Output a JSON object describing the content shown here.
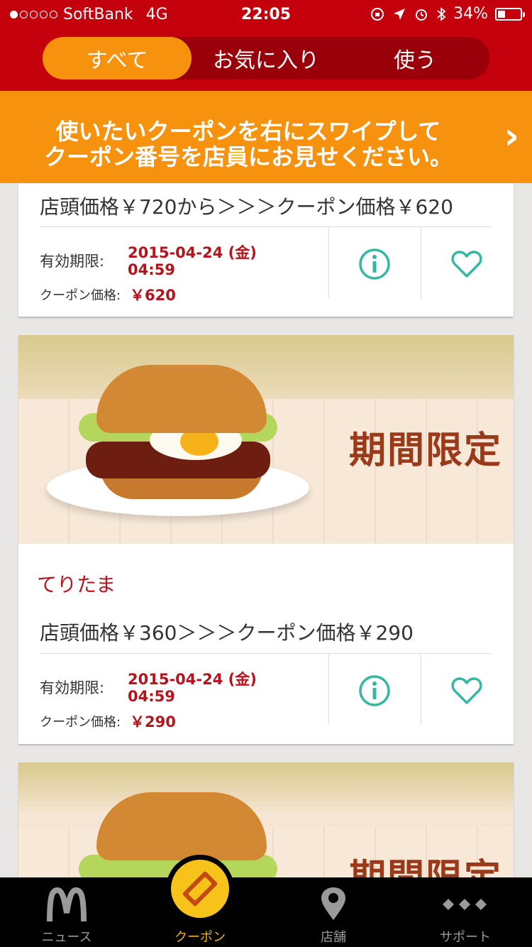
{
  "status_bar": {
    "carrier": "SoftBank",
    "network": "4G",
    "time": "22:05",
    "battery": "34%",
    "battery_level": 0.34,
    "signal_bars": 1,
    "signal_total": 5
  },
  "segmented": {
    "tabs": [
      {
        "label": "すべて",
        "active": true
      },
      {
        "label": "お気に入り",
        "active": false
      },
      {
        "label": "使う",
        "active": false
      }
    ]
  },
  "banner": {
    "line1": "使いたいクーポンを右にスワイプして",
    "line2": "クーポン番号を店員にお見せください。",
    "chevron": "›"
  },
  "coupons": [
    {
      "name": "",
      "price_text": "店頭価格￥720から＞＞＞クーポン価格￥620",
      "valid_label": "有効期限:",
      "valid_date": "2015-04-24 (金)",
      "valid_time": "04:59",
      "coupon_price_label": "クーポン価格:",
      "coupon_price": "￥620"
    },
    {
      "badge": "期間限定",
      "name": "てりたま",
      "price_text": "店頭価格￥360＞＞＞クーポン価格￥290",
      "valid_label": "有効期限:",
      "valid_date": "2015-04-24 (金)",
      "valid_time": "04:59",
      "coupon_price_label": "クーポン価格:",
      "coupon_price": "￥290"
    },
    {
      "badge": "期間限定"
    }
  ],
  "tab_bar": {
    "items": [
      {
        "label": "ニュース",
        "icon": "mcdonalds-logo-icon",
        "active": false
      },
      {
        "label": "クーポン",
        "icon": "coupon-icon",
        "active": true
      },
      {
        "label": "店舗",
        "icon": "location-pin-icon",
        "active": false
      },
      {
        "label": "サポート",
        "icon": "more-dots-icon",
        "active": false
      }
    ]
  },
  "colors": {
    "header_red": "#c4000d",
    "accent_orange": "#f7920f",
    "coupon_red": "#b5141c",
    "icon_teal": "#34b8a3"
  }
}
